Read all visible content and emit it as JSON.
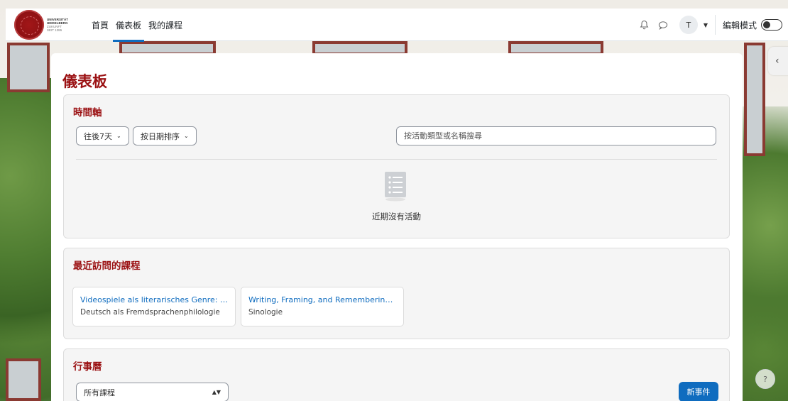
{
  "logo": {
    "line1": "UNIVERSITÄT",
    "line2": "HEIDELBERG",
    "line3": "ZUKUNFT",
    "line4": "SEIT 1386"
  },
  "nav": {
    "links": [
      {
        "label": "首頁",
        "active": false
      },
      {
        "label": "儀表板",
        "active": true
      },
      {
        "label": "我的課程",
        "active": false
      }
    ],
    "notification_icon": "bell-icon",
    "message_icon": "chat-bubble-icon",
    "avatar_initial": "T",
    "edit_mode_label": "編輯模式"
  },
  "page": {
    "title": "儀表板"
  },
  "timeline": {
    "title": "時間軸",
    "range_filter": "往後7天",
    "sort_filter": "按日期排序",
    "search_placeholder": "按活動類型或名稱搜尋",
    "empty_text": "近期沒有活動"
  },
  "recent_courses": {
    "title": "最近訪問的課程",
    "items": [
      {
        "title": "Videospiele als literarisches Genre: Mö...",
        "category": "Deutsch als Fremdsprachenphilologie"
      },
      {
        "title": "Writing, Framing, and Remembering Di...",
        "category": "Sinologie"
      }
    ]
  },
  "calendar": {
    "title": "行事曆",
    "course_filter": "所有課程",
    "new_event_label": "新事件"
  },
  "help": {
    "label": "?"
  },
  "colors": {
    "brand_red": "#9b1214",
    "link_blue": "#0f6cbf",
    "block_bg": "#f5f5f5"
  }
}
